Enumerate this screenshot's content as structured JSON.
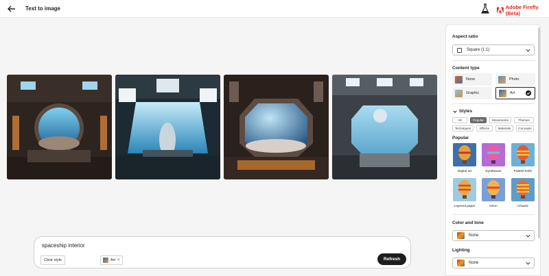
{
  "header": {
    "title": "Text to image",
    "brand": "Adobe Firefly (Beta)",
    "back_icon": "arrow-left-icon",
    "labs_icon": "flask-icon",
    "brand_color": "#e1251b"
  },
  "gallery": {
    "images": [
      {
        "alt": "spaceship interior 1"
      },
      {
        "alt": "spaceship interior 2"
      },
      {
        "alt": "spaceship interior 3"
      },
      {
        "alt": "spaceship interior 4"
      }
    ]
  },
  "prompt": {
    "text": "spaceship interior",
    "clear_style": "Clear style",
    "chip_label": "Art",
    "chip_close": "×",
    "refresh": "Refresh"
  },
  "panel": {
    "aspect_ratio": {
      "title": "Aspect ratio",
      "value": "Square (1:1)"
    },
    "content_type": {
      "title": "Content type",
      "items": [
        "None",
        "Photo",
        "Graphic",
        "Art"
      ],
      "selected": "Art"
    },
    "styles": {
      "title": "Styles",
      "tabs_row1": [
        "All",
        "Popular",
        "Movements",
        "Themes"
      ],
      "tabs_row2": [
        "Techniques",
        "Effects",
        "Materials",
        "Concepts"
      ],
      "active_tab": "Popular",
      "section": "Popular",
      "cards": [
        "Digital art",
        "Synthwave",
        "Palette knife",
        "Layered paper",
        "Neon",
        "Chaotic"
      ]
    },
    "color_tone": {
      "title": "Color and tone",
      "value": "None"
    },
    "lighting": {
      "title": "Lighting",
      "value": "None"
    }
  },
  "colors": {
    "accent": "#1e1e1e",
    "panel_bg": "#ffffff",
    "page_bg": "#f5f5f5"
  }
}
